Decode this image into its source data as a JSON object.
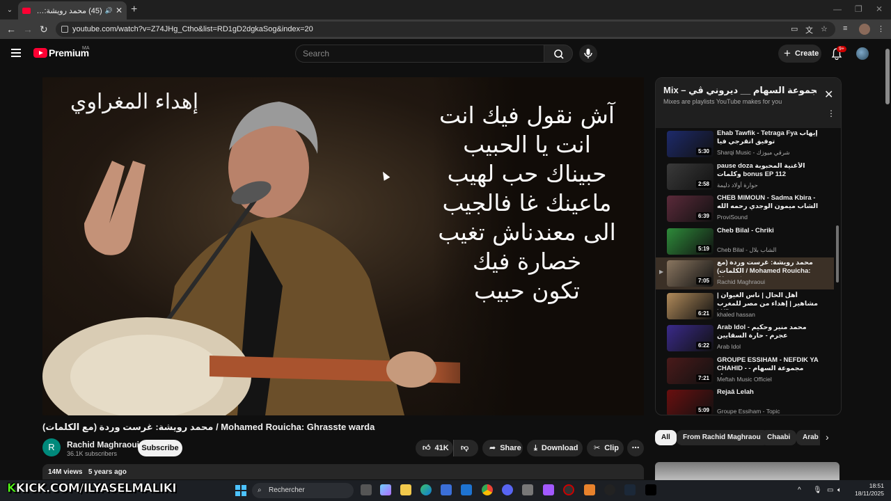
{
  "browser": {
    "tab_title": "(45) محمد رويشة: غرست وردة",
    "tab_speaker": "🔊",
    "url": "youtube.com/watch?v=Z74JHg_Ctho&list=RD1gD2dgkaSog&index=20"
  },
  "masthead": {
    "premium_label": "Premium",
    "region": "MA",
    "search_placeholder": "Search",
    "create_label": "Create",
    "notif_badge": "9+"
  },
  "video": {
    "caption": "إهداء المغراوي",
    "lyrics": [
      "آش نقول فيك انت",
      "انت يا الحبيب",
      "حبيناك حب لهيب",
      "ماعينك غا فالجيب",
      "الى معندناش تغيب",
      "خصارة فيك",
      "تكون حبيب"
    ],
    "title": "محمد رويشة: غرست وردة (مع الكلمات) / Mohamed Rouicha: Ghrasste warda",
    "channel": "Rachid Maghraoui",
    "channel_initial": "R",
    "subscribers": "36.1K subscribers",
    "subscribe_label": "Subscribe",
    "likes": "41K",
    "share_label": "Share",
    "download_label": "Download",
    "clip_label": "Clip",
    "views": "14M views",
    "age": "5 years ago"
  },
  "mix": {
    "title": "Mix – مجموعة السهام __ ديروني ڤي",
    "subtitle": "Mixes are playlists YouTube makes for you",
    "items": [
      {
        "title": "Ehab Tawfik - Tetraga Fya إيهاب توفيق اتقرجي فيا",
        "channel": "Sharqi Music - شرقي ميوزك",
        "duration": "5:30",
        "color": "#1d2a6b"
      },
      {
        "title": "pause doza الأغنية المحبوبة وكلمات bonus EP 112",
        "channel": "حوارة أولاد دليمة",
        "duration": "2:58",
        "color": "#3a3a3a"
      },
      {
        "title": "CHEB MIMOUN - Sadma Kbira - الشاب ميمون الوجدي رحمه الله - صدمة",
        "channel": "ProviSound",
        "duration": "6:39",
        "color": "#5b2a3a"
      },
      {
        "title": "Cheb Bilal - Chriki",
        "channel": "Cheb Bilal - الشاب بلال",
        "duration": "5:19",
        "color": "#2e8b3a"
      },
      {
        "title": "محمد رويشة: غرست وردة (مع الكلمات) / Mohamed Rouicha: Ghrasste...",
        "channel": "Rachid Maghraoui",
        "duration": "7:05",
        "color": "#8a7660",
        "current": true,
        "index": "▶"
      },
      {
        "title": "أهل الحال | ناس الغيوان | مشاهير | إهداء من مصر للمغرب | HD",
        "channel": "khaled hassan",
        "duration": "6:21",
        "color": "#b08a5a"
      },
      {
        "title": "Arab Idol - محمد منير وحكيم عجرم - حارة السقايين",
        "channel": "Arab Idol",
        "duration": "6:22",
        "color": "#3a2a8a"
      },
      {
        "title": "GROUPE ESSIHAM - NEFDIK YA CHAHID - مجموعة السهام - نفديك",
        "channel": "Meftah Music Officiel",
        "duration": "7:21",
        "color": "#4a1a1a"
      },
      {
        "title": "Rejaâ Lelah",
        "channel": "Groupe Essiham - Topic",
        "duration": "5:09",
        "color": "#6a0f0f"
      }
    ]
  },
  "chips": [
    "All",
    "From Rachid Maghraoui",
    "Chaabi",
    "Arab"
  ],
  "taskbar": {
    "overlay_text": "KICK.COM/ILYASELMALIKI",
    "search_label": "Rechercher",
    "time": "18:51",
    "date": "18/11/2025"
  }
}
